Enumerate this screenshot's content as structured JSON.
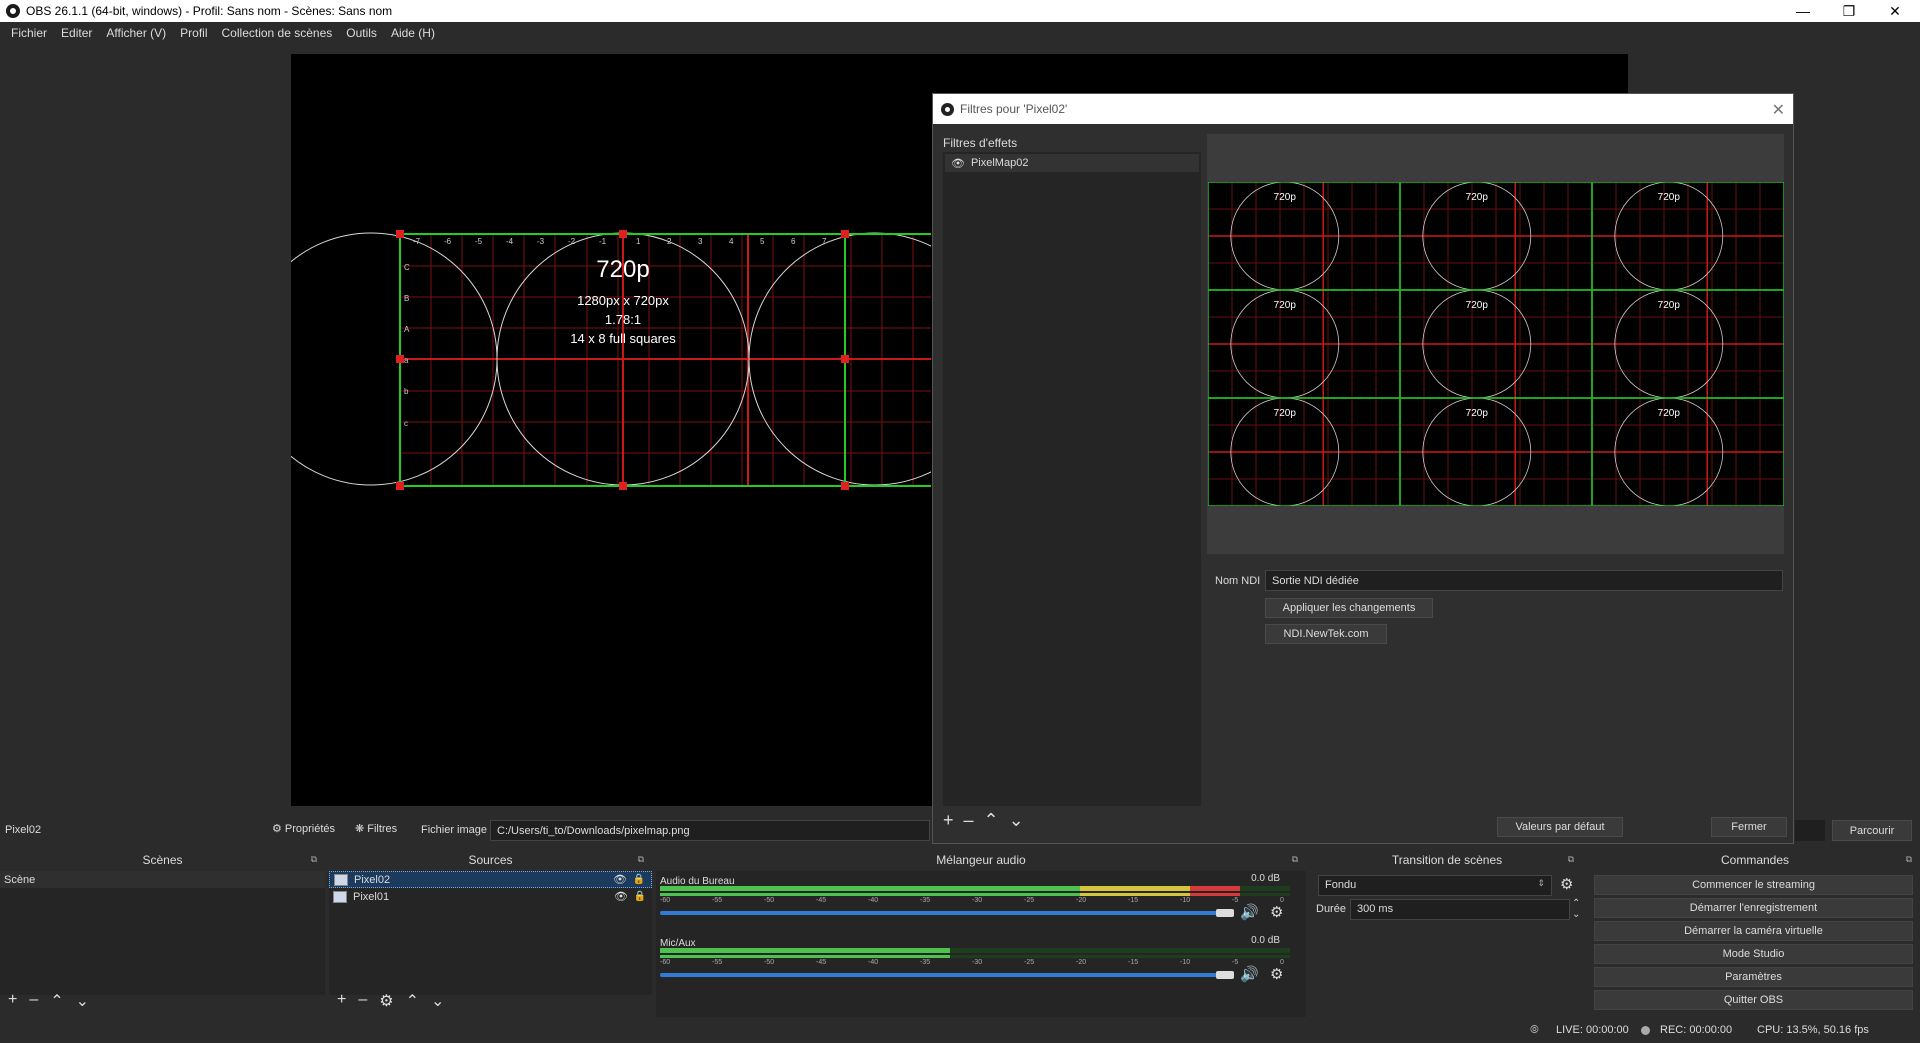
{
  "window": {
    "title": "OBS 26.1.1 (64-bit, windows) - Profil: Sans nom - Scènes: Sans nom"
  },
  "menu": [
    "Fichier",
    "Editer",
    "Afficher (V)",
    "Profil",
    "Collection de scènes",
    "Outils",
    "Aide (H)"
  ],
  "preview": {
    "heading": "720p",
    "lines": [
      "1280px x 720px",
      "1.78:1",
      "14 x 8 full squares"
    ],
    "left_letters": [
      "C",
      "B",
      "A",
      "a",
      "b",
      "c"
    ],
    "top_ticks": [
      "-7",
      "-6",
      "-5",
      "-4",
      "-3",
      "-2",
      "-1",
      "",
      "1",
      "2",
      "3",
      "4",
      "5",
      "6",
      "7"
    ]
  },
  "filters_dialog": {
    "title": "Filtres pour 'Pixel02'",
    "section_label": "Filtres d'effets",
    "filters": [
      "PixelMap02"
    ],
    "tile_heading": "720p",
    "ndi_label": "Nom NDI",
    "ndi_value": "Sortie NDI dédiée",
    "apply_button": "Appliquer les changements",
    "link_button": "NDI.NewTek.com",
    "defaults_button": "Valeurs par défaut",
    "close_button": "Fermer"
  },
  "source_toolbar": {
    "source_name": "Pixel02",
    "properties": "Propriétés",
    "filters": "Filtres",
    "file_label": "Fichier image",
    "file_path": "C:/Users/ti_to/Downloads/pixelmap.png",
    "browse": "Parcourir"
  },
  "docks": {
    "scenes": {
      "title": "Scènes",
      "items": [
        "Scène"
      ]
    },
    "sources": {
      "title": "Sources",
      "items": [
        "Pixel02",
        "Pixel01"
      ]
    },
    "mixer": {
      "title": "Mélangeur audio",
      "channels": [
        {
          "name": "Audio du Bureau",
          "db": "0.0 dB"
        },
        {
          "name": "Mic/Aux",
          "db": "0.0 dB"
        }
      ],
      "ticks": [
        "-60",
        "-55",
        "-50",
        "-45",
        "-40",
        "-35",
        "-30",
        "-25",
        "-20",
        "-15",
        "-10",
        "-5",
        "0"
      ]
    },
    "transition": {
      "title": "Transition de scènes",
      "type": "Fondu",
      "duration_label": "Durée",
      "duration_value": "300 ms"
    },
    "commands": {
      "title": "Commandes",
      "buttons": [
        "Commencer le streaming",
        "Démarrer l'enregistrement",
        "Démarrer la caméra virtuelle",
        "Mode Studio",
        "Paramètres",
        "Quitter OBS"
      ]
    }
  },
  "status": {
    "live": "LIVE: 00:00:00",
    "rec": "REC: 00:00:00",
    "cpu": "CPU: 13.5%, 50.16 fps"
  }
}
